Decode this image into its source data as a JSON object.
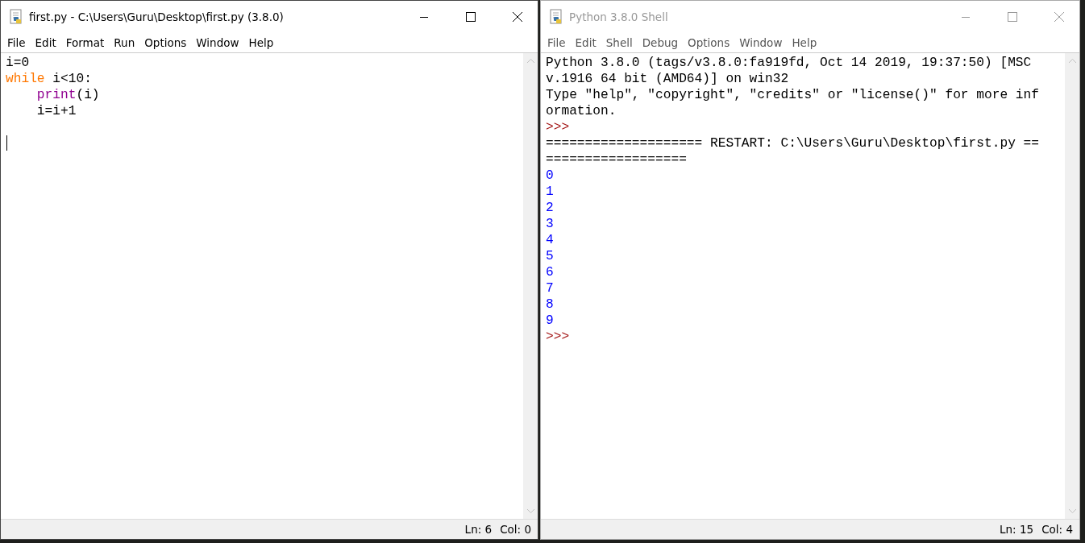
{
  "windows": [
    {
      "title": "first.py - C:\\Users\\Guru\\Desktop\\first.py (3.8.0)",
      "active": true,
      "menu": [
        "File",
        "Edit",
        "Format",
        "Run",
        "Options",
        "Window",
        "Help"
      ],
      "lines": [
        [
          {
            "text": "i=0",
            "kind": "plain"
          }
        ],
        [
          {
            "text": "while",
            "kind": "keyword"
          },
          {
            "text": " i<10:",
            "kind": "plain"
          }
        ],
        [
          {
            "text": "print",
            "kind": "builtin",
            "indent": true
          },
          {
            "text": "(i)",
            "kind": "plain"
          }
        ],
        [
          {
            "text": "i=i+1",
            "kind": "plain",
            "indent": true
          }
        ]
      ],
      "cursor": true,
      "status": {
        "line": "Ln: 6",
        "col": "Col: 0"
      }
    },
    {
      "title": "Python 3.8.0 Shell",
      "active": false,
      "menu": [
        "File",
        "Edit",
        "Shell",
        "Debug",
        "Options",
        "Window",
        "Help"
      ],
      "lines": [
        [
          {
            "text": "Python 3.8.0 (tags/v3.8.0:fa919fd, Oct 14 2019, 19:37:50) [MSC",
            "kind": "plain"
          }
        ],
        [
          {
            "text": "v.1916 64 bit (AMD64)] on win32",
            "kind": "plain"
          }
        ],
        [
          {
            "text": "Type \"help\", \"copyright\", \"credits\" or \"license()\" for more inf",
            "kind": "plain"
          }
        ],
        [
          {
            "text": "ormation.",
            "kind": "plain"
          }
        ],
        [
          {
            "text": ">>>",
            "kind": "prompt"
          }
        ],
        [
          {
            "text": "==================== RESTART: C:\\Users\\Guru\\Desktop\\first.py ==",
            "kind": "plain"
          }
        ],
        [
          {
            "text": "==================",
            "kind": "plain"
          }
        ],
        [
          {
            "text": "0",
            "kind": "output"
          }
        ],
        [
          {
            "text": "1",
            "kind": "output"
          }
        ],
        [
          {
            "text": "2",
            "kind": "output"
          }
        ],
        [
          {
            "text": "3",
            "kind": "output"
          }
        ],
        [
          {
            "text": "4",
            "kind": "output"
          }
        ],
        [
          {
            "text": "5",
            "kind": "output"
          }
        ],
        [
          {
            "text": "6",
            "kind": "output"
          }
        ],
        [
          {
            "text": "7",
            "kind": "output"
          }
        ],
        [
          {
            "text": "8",
            "kind": "output"
          }
        ],
        [
          {
            "text": "9",
            "kind": "output"
          }
        ],
        [
          {
            "text": ">>>",
            "kind": "prompt"
          }
        ]
      ],
      "cursor": false,
      "status": {
        "line": "Ln: 15",
        "col": "Col: 4"
      }
    }
  ]
}
